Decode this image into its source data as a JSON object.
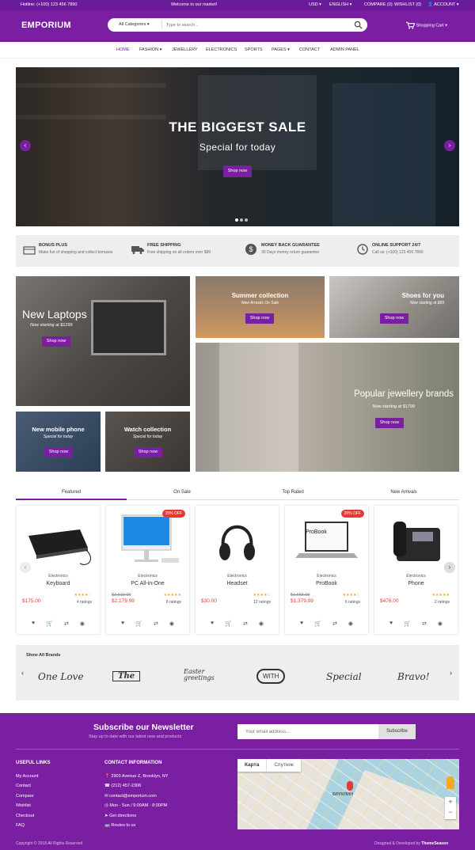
{
  "topbar": {
    "hotline": "Hotline: (+100) 123 456 7890",
    "welcome": "Welcome to our market!",
    "currency": "USD",
    "language": "ENGLISH",
    "compare": "COMPARE (0)",
    "wishlist": "WISHLIST (0)",
    "account": "ACCOUNT"
  },
  "header": {
    "logo": "EMPORIUM",
    "category": "All Categories",
    "search_placeholder": "Type to search...",
    "cart": "Shopping Cart"
  },
  "nav": {
    "items": [
      "HOME",
      "FASHION",
      "JEWELLERY",
      "ELECTRONICS",
      "SPORTS",
      "PAGES",
      "CONTACT",
      "ADMIN PANEL"
    ]
  },
  "hero": {
    "title": "THE BIGGEST SALE",
    "subtitle": "Special for today",
    "button": "Shop now"
  },
  "features": [
    {
      "title": "BONUS PLUS",
      "desc": "Make fun of shopping and collect bonuses",
      "icon": "gift-icon"
    },
    {
      "title": "FREE SHIPPING",
      "desc": "Free shipping on all orders over $99",
      "icon": "truck-icon"
    },
    {
      "title": "MONEY BACK GUARANTEE",
      "desc": "30 Days money return guarantee",
      "icon": "dollar-icon"
    },
    {
      "title": "ONLINE SUPPORT 24/7",
      "desc": "Call us: (+100) 123 456 7890",
      "icon": "history-icon"
    }
  ],
  "promos": {
    "laptops": {
      "title": "New Laptops",
      "sub": "Now starting at $1299",
      "btn": "Shop now"
    },
    "summer": {
      "title": "Summer collection",
      "sub": "New Arrivals On Sale",
      "btn": "Shop now"
    },
    "shoes": {
      "title": "Shoes for you",
      "sub": "Now starting at $99",
      "btn": "Shop now"
    },
    "jewellery": {
      "title": "Popular jewellery brands",
      "sub": "Now starting at $1799",
      "btn": "Shop now"
    },
    "phone": {
      "title": "New mobile phone",
      "sub": "Special for today",
      "btn": "Shop now"
    },
    "watch": {
      "title": "Watch collection",
      "sub": "Special for today",
      "btn": "Shop now"
    }
  },
  "tabs": [
    "Featured",
    "On Sale",
    "Top Rated",
    "New Arrivals"
  ],
  "products": [
    {
      "cat": "Electronics",
      "name": "Keyboard",
      "old": "",
      "price": "$175.00",
      "stars": "★★★★☆",
      "ratings": "4 ratings",
      "badge": ""
    },
    {
      "cat": "Electronics",
      "name": "PC All-in-One",
      "old": "$2,510.00",
      "price": "$2,179.99",
      "stars": "★★★★★",
      "ratings": "8 ratings",
      "badge": "15% OFF"
    },
    {
      "cat": "Electronics",
      "name": "Headset",
      "old": "",
      "price": "$30.00",
      "stars": "★★★★☆",
      "ratings": "12 ratings",
      "badge": ""
    },
    {
      "cat": "Electronics",
      "name": "ProBook",
      "old": "$1,655.00",
      "price": "$1,379.99",
      "stars": "★★★★☆",
      "ratings": "6 ratings",
      "badge": "20% OFF"
    },
    {
      "cat": "Electronics",
      "name": "Phone",
      "old": "",
      "price": "$476.00",
      "stars": "★★★★★",
      "ratings": "2 ratings",
      "badge": ""
    }
  ],
  "brands": {
    "title": "Show All Brands",
    "names": [
      "One Love",
      "The",
      "Easter greetings",
      "WITH",
      "Special",
      "Bravo!"
    ]
  },
  "newsletter": {
    "title": "Subscribe our Newsletter",
    "desc": "Stay up to date with our latest new and products",
    "placeholder": "Your email address...",
    "button": "Subscribe"
  },
  "footer": {
    "useful_title": "USEFUL LINKS",
    "useful": [
      "My Account",
      "Contact",
      "Compare",
      "Wishlist",
      "Checkout",
      "FAQ"
    ],
    "contact_title": "CONTACT INFORMATION",
    "contact": [
      "2903 Avenue Z, Brooklyn, NY",
      "(212) 457-2308",
      "contact@emporium.com",
      "Mon - Sun / 9:00AM - 8:00PM",
      "Get directions",
      "Routes to us"
    ],
    "map_tabs": [
      "Карта",
      "Спутник"
    ],
    "map_label": "БРУКЛИН",
    "copyright": "Copyright © 2018 All Rights Reserved",
    "designed": "Designed & Developed by",
    "designer": "ThemeSeason"
  },
  "colors": {
    "accent": "#7b1fa2",
    "sale": "#e53935",
    "stars": "#f9a825"
  }
}
